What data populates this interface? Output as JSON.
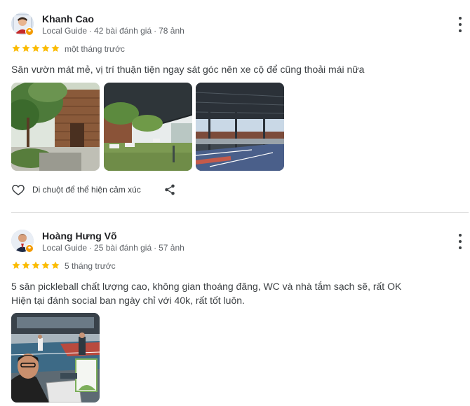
{
  "reviews": [
    {
      "name": "Khanh Cao",
      "guide": "Local Guide",
      "review_count": "42 bài đánh giá",
      "photo_count": "78 ảnh",
      "rating": 5,
      "when": "một tháng trước",
      "text_lines": [
        "Sân vườn mát mẻ, vị trí thuận tiện ngay sát góc nên xe cộ để cũng thoải mái nữa"
      ],
      "like_hint": "Di chuột để thể hiện cảm xúc"
    },
    {
      "name": "Hoàng Hưng Võ",
      "guide": "Local Guide",
      "review_count": "25 bài đánh giá",
      "photo_count": "57 ảnh",
      "rating": 5,
      "when": "5 tháng trước",
      "text_lines": [
        "5 sân pickleball chất lượng cao, không gian thoáng đãng, WC và nhà tắm sạch sẽ, rất OK",
        "Hiện tại đánh social ban ngày chỉ với 40k, rất tốt luôn."
      ]
    }
  ],
  "colors": {
    "star": "#fbbc04",
    "meta": "#5f6368",
    "badge": "#f29900",
    "divider": "#e0e0e0"
  },
  "icons": {
    "more": "more-vert-icon",
    "like": "heart-outline-icon",
    "share": "share-icon",
    "star": "star-icon"
  }
}
